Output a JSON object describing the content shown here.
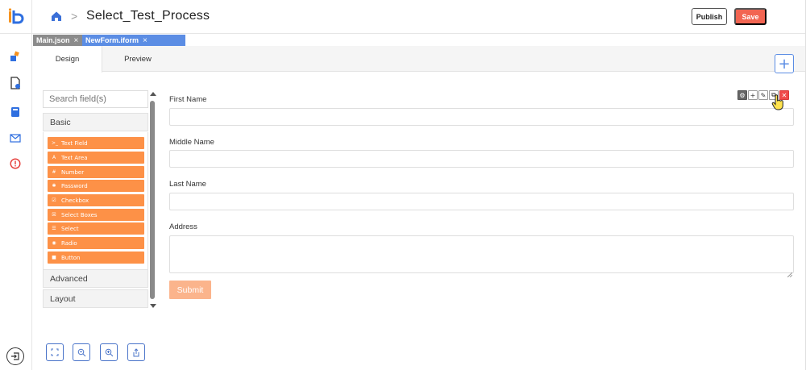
{
  "header": {
    "home_icon": "home-icon",
    "separator": ">",
    "title": "Select_Test_Process",
    "publish_label": "Publish",
    "save_label": "Save"
  },
  "rail": {
    "logo": "ib",
    "icons": [
      "workflow-icon",
      "document-settings-icon",
      "storage-icon",
      "mail-icon",
      "alert-icon"
    ],
    "bottom_icon": "logout-icon"
  },
  "file_tabs": [
    {
      "label": "Main.json",
      "close": "×"
    },
    {
      "label": "NewForm.iform",
      "close": "×"
    }
  ],
  "mode_tabs": {
    "design": "Design",
    "preview": "Preview",
    "add": "+"
  },
  "palette": {
    "search_placeholder": "Search field(s)",
    "groups": {
      "basic": "Basic",
      "advanced": "Advanced",
      "layout": "Layout"
    },
    "components": [
      {
        "icon": ">_",
        "label": "Text Field"
      },
      {
        "icon": "A",
        "label": "Text Area"
      },
      {
        "icon": "#",
        "label": "Number"
      },
      {
        "icon": "✱",
        "label": "Password"
      },
      {
        "icon": "☑",
        "label": "Checkbox"
      },
      {
        "icon": "☒",
        "label": "Select Boxes"
      },
      {
        "icon": "☰",
        "label": "Select"
      },
      {
        "icon": "◉",
        "label": "Radio"
      },
      {
        "icon": "■",
        "label": "Button"
      }
    ]
  },
  "form": {
    "fields": [
      {
        "label": "First Name"
      },
      {
        "label": "Middle Name"
      },
      {
        "label": "Last Name"
      }
    ],
    "address_label": "Address",
    "submit_label": "Submit"
  },
  "colors": {
    "accent_blue": "#5b8de4",
    "component_orange": "#fd9147",
    "save_red": "#f26552",
    "submit_light": "#fbb48c"
  }
}
